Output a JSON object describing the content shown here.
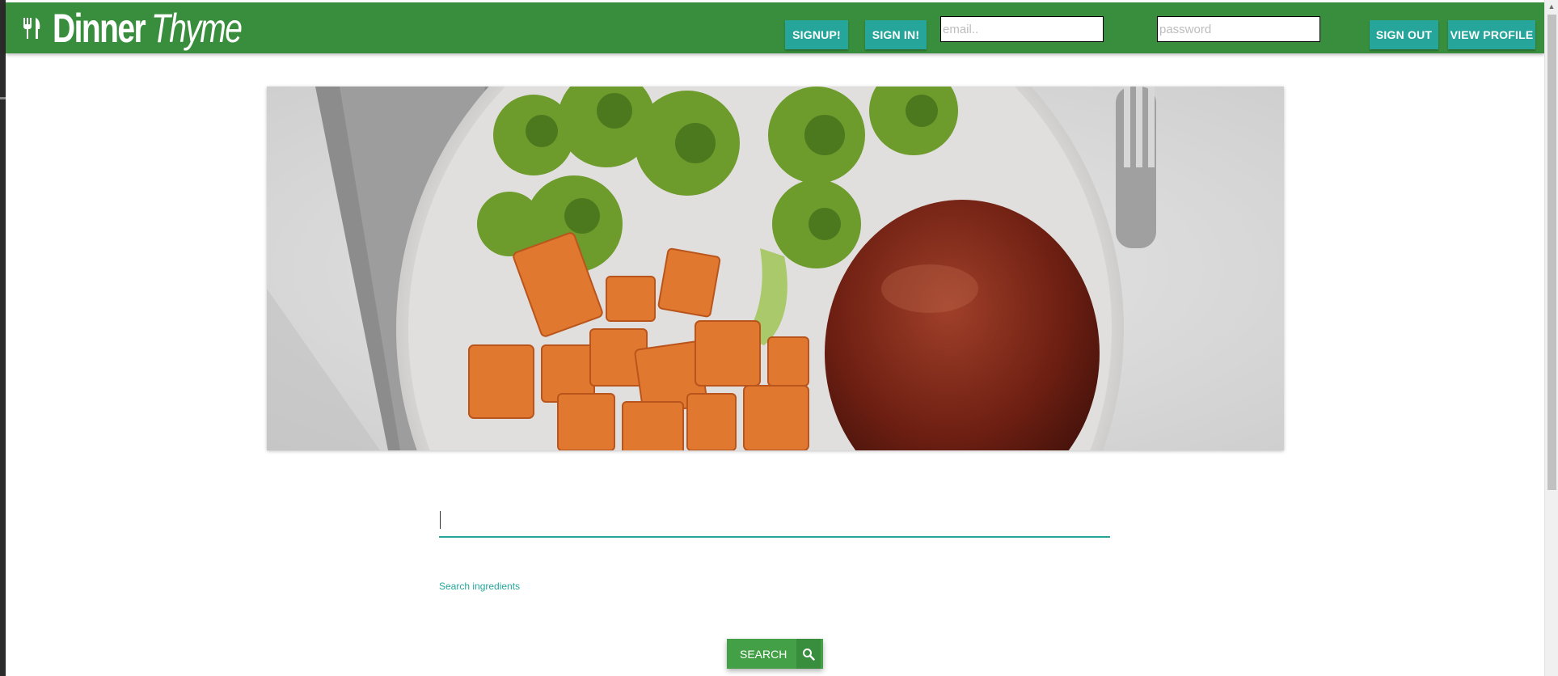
{
  "navbar": {
    "brand_first": "Dinner",
    "brand_second": "Thyme",
    "signup_label": "SIGNUP!",
    "signin_label": "SIGN IN!",
    "email_placeholder": "email..",
    "password_placeholder": "password",
    "signout_label": "SIGN OUT",
    "view_profile_label": "VIEW PROFILE",
    "icons": {
      "brand": "fork-knife-icon"
    },
    "colors": {
      "bar": "#388e3c",
      "button": "#26a69a"
    }
  },
  "hero": {
    "image": "plate of roasted broccoli, sweet potato cubes and glazed meatloaf with a fork"
  },
  "search": {
    "value": "",
    "label": "Search ingredients",
    "button_label": "SEARCH",
    "button_icon": "search-icon",
    "colors": {
      "underline": "#26a69a",
      "button": "#43a047"
    }
  }
}
